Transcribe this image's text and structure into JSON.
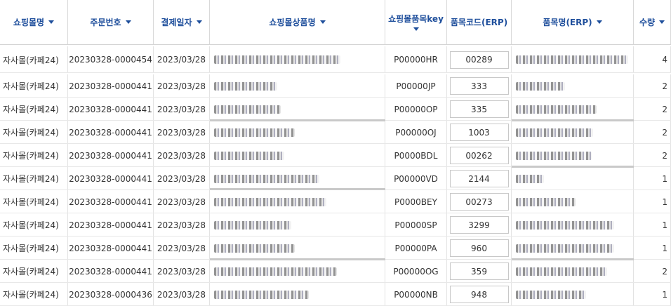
{
  "columns": [
    {
      "label": "쇼핑몰명",
      "sortable": true
    },
    {
      "label": "주문번호",
      "sortable": true
    },
    {
      "label": "결제일자",
      "sortable": true
    },
    {
      "label": "쇼핑몰상품명",
      "sortable": true
    },
    {
      "label": "쇼핑몰품목key",
      "sortable": true
    },
    {
      "label": "품목코드(ERP)",
      "sortable": false
    },
    {
      "label": "품목명(ERP)",
      "sortable": true
    },
    {
      "label": "수량",
      "sortable": true
    }
  ],
  "rows": [
    {
      "mall": "자사몰(카페24)",
      "order_no": "20230328-0000454",
      "pay_date": "2023/03/28",
      "item_key": "P00000HR",
      "erp_code": "00289",
      "qty": "4"
    },
    {
      "mall": "자사몰(카페24)",
      "order_no": "20230328-0000441",
      "pay_date": "2023/03/28",
      "item_key": "P00000JP",
      "erp_code": "333",
      "qty": "2"
    },
    {
      "mall": "자사몰(카페24)",
      "order_no": "20230328-0000441",
      "pay_date": "2023/03/28",
      "item_key": "P00000OP",
      "erp_code": "335",
      "qty": "2"
    },
    {
      "mall": "자사몰(카페24)",
      "order_no": "20230328-0000441",
      "pay_date": "2023/03/28",
      "item_key": "P00000OJ",
      "erp_code": "1003",
      "qty": "2"
    },
    {
      "mall": "자사몰(카페24)",
      "order_no": "20230328-0000441",
      "pay_date": "2023/03/28",
      "item_key": "P0000BDL",
      "erp_code": "00262",
      "qty": "2"
    },
    {
      "mall": "자사몰(카페24)",
      "order_no": "20230328-0000441",
      "pay_date": "2023/03/28",
      "item_key": "P00000VD",
      "erp_code": "2144",
      "qty": "1"
    },
    {
      "mall": "자사몰(카페24)",
      "order_no": "20230328-0000441",
      "pay_date": "2023/03/28",
      "item_key": "P0000BEY",
      "erp_code": "00273",
      "qty": "1"
    },
    {
      "mall": "자사몰(카페24)",
      "order_no": "20230328-0000441",
      "pay_date": "2023/03/28",
      "item_key": "P00000SP",
      "erp_code": "3299",
      "qty": "1"
    },
    {
      "mall": "자사몰(카페24)",
      "order_no": "20230328-0000441",
      "pay_date": "2023/03/28",
      "item_key": "P00000PA",
      "erp_code": "960",
      "qty": "1"
    },
    {
      "mall": "자사몰(카페24)",
      "order_no": "20230328-0000441",
      "pay_date": "2023/03/28",
      "item_key": "P00000OG",
      "erp_code": "359",
      "qty": "2"
    },
    {
      "mall": "자사몰(카페24)",
      "order_no": "20230328-0000436",
      "pay_date": "2023/03/28",
      "item_key": "P00000NB",
      "erp_code": "948",
      "qty": "1"
    }
  ]
}
